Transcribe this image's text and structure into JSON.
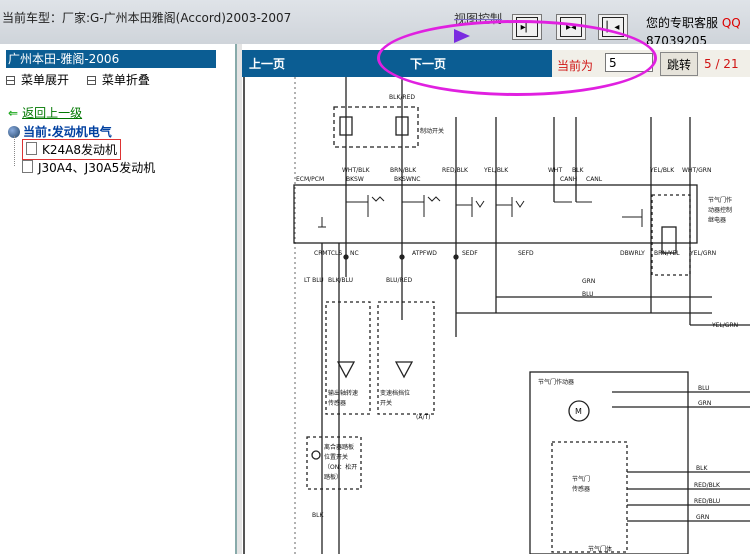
{
  "topbar": {
    "title": "当前车型：厂家:G-广州本田雅阁(Accord)2003-2007",
    "control_label": "视图控制",
    "service_label": "您的专职客服",
    "service_qq": "QQ",
    "service_phone": "87039205",
    "button_icons": [
      "fit-width-icon",
      "fit-both-icon",
      "fit-page-icon"
    ]
  },
  "sidebar": {
    "header": "广州本田-雅阁-2006",
    "expand_label": "菜单展开",
    "collapse_label": "菜单折叠",
    "back_label": "返回上一级",
    "current_label": "当前:发动机电气",
    "items": [
      {
        "label": "K24A8发动机",
        "selected": true
      },
      {
        "label": "J30A4、J30A5发动机",
        "selected": false
      }
    ]
  },
  "viewer": {
    "prev_label": "上一页",
    "next_label": "下一页",
    "current_page_label": "当前为",
    "page_input_value": "5",
    "jump_label": "跳转",
    "page_count": "5 / 21"
  },
  "diagram": {
    "labels": {
      "blk_red": "BLK/RED",
      "brake_switch": "制动开关",
      "wht_blk": "WHT/BLK",
      "brn_blk": "BRN/BLK",
      "red_blk": "RED/BLK",
      "yel_blk": "YEL/BLK",
      "wht": "WHT",
      "blk": "BLK",
      "yel_blk2": "YEL/BLK",
      "wht_grn": "WHT/GRN",
      "ecm_pcm": "ECM/PCM",
      "bksw": "BKSW",
      "bkswnc": "BKSWNC",
      "canh": "CANH",
      "canl": "CANL",
      "throttle_relay_1": "节气门作",
      "throttle_relay_2": "动器控制",
      "throttle_relay_3": "继电器",
      "crmtcls": "CRMTCLS",
      "nc": "NC",
      "atpfwd": "ATPFWD",
      "sedf": "SEDF",
      "sefd": "SEFD",
      "dbwrly": "DBWRLY",
      "brn_yel": "BRN/YEL",
      "yel_grn": "YEL/GRN",
      "grn": "GRN",
      "blu": "BLU",
      "lt_blu": "LT BLU",
      "blk_blu": "BLK/BLU",
      "blu_red": "BLU/RED",
      "output_sensor_1": "输出轴转速",
      "output_sensor_2": "传感器",
      "range_switch_1": "变速档挡位",
      "range_switch_2": "开关",
      "at": "(A/T)",
      "yel_grn2": "YEL/GRN",
      "actuator": "节气门作动器",
      "m": "M",
      "blu2": "BLU",
      "grn2": "GRN",
      "tp_sensor_1": "节气门",
      "tp_sensor_2": "传感器",
      "blk2": "BLK",
      "red_blk2": "RED/BLK",
      "red_blu": "RED/BLU",
      "grn3": "GRN",
      "throttle_body": "节气门体",
      "clutch_1": "离合器踏板",
      "clutch_2": "位置开关",
      "clutch_3": "（ON：松开",
      "clutch_4": "踏板）",
      "blk3": "BLK"
    }
  },
  "colors": {
    "accent_blue": "#0b5d93",
    "page_red": "#d01414",
    "highlight_oval": "#e020e0"
  }
}
